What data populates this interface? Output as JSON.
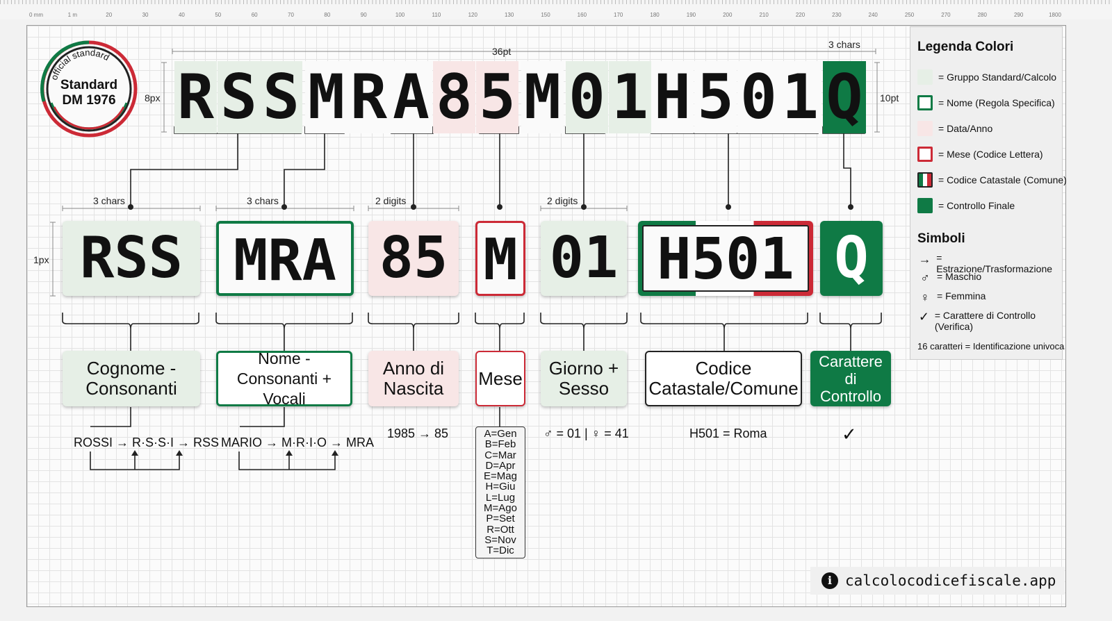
{
  "ruler": {
    "labels": [
      "0 mm",
      "1 m",
      "20",
      "30",
      "40",
      "50",
      "60",
      "70",
      "80",
      "90",
      "100",
      "110",
      "120",
      "130",
      "150",
      "160",
      "170",
      "180",
      "190",
      "200",
      "210",
      "220",
      "230",
      "240",
      "250",
      "270",
      "280",
      "290",
      "1800"
    ]
  },
  "seal": {
    "arc_text": "official standard",
    "line1": "Standard",
    "line2": "DM 1976"
  },
  "code": {
    "characters": [
      "R",
      "S",
      "S",
      "M",
      "R",
      "A",
      "8",
      "5",
      "M",
      "0",
      "1",
      "H",
      "5",
      "0",
      "1",
      "Q"
    ],
    "top_dimension": "36pt",
    "left_dimension": "8px",
    "right_dimension": "10pt",
    "check_dimension": "3 chars"
  },
  "segments": [
    {
      "code": "RSS",
      "count_label": "3 chars",
      "description": "Cognome - Consonanti",
      "example": "ROSSI → R·S·S·I → RSS"
    },
    {
      "code": "MRA",
      "count_label": "3 chars",
      "description": "Nome - Consonanti + Vocali",
      "example": "MARIO → M·R·I·O → MRA"
    },
    {
      "code": "85",
      "count_label": "2 digits",
      "description": "Anno di Nascita",
      "example": "1985 → 85"
    },
    {
      "code": "M",
      "count_label": "",
      "description": "Mese",
      "example": ""
    },
    {
      "code": "01",
      "count_label": "2 digits",
      "description": "Giorno + Sesso",
      "example": "♂ = 01 | ♀ = 41"
    },
    {
      "code": "H501",
      "count_label": "",
      "description": "Codice Catastale/Comune",
      "example": "H501 = Roma"
    },
    {
      "code": "Q",
      "count_label": "",
      "description": "Carattere di Controllo",
      "example": "✓"
    }
  ],
  "row_dimension": "1px",
  "months": [
    "A=Gen",
    "B=Feb",
    "C=Mar",
    "D=Apr",
    "E=Mag",
    "H=Giu",
    "L=Lug",
    "M=Ago",
    "P=Set",
    "R=Ott",
    "S=Nov",
    "T=Dic"
  ],
  "legend": {
    "title": "Legenda Colori",
    "colors": [
      {
        "label": "= Gruppo Standard/Calcolo",
        "style": "light-green"
      },
      {
        "label": "= Nome (Regola Specifica)",
        "style": "green-border"
      },
      {
        "label": "= Data/Anno",
        "style": "light-pink"
      },
      {
        "label": "= Mese (Codice Lettera)",
        "style": "red-border"
      },
      {
        "label": "= Codice Catastale (Comune)",
        "style": "italian-flag"
      },
      {
        "label": "= Controllo Finale",
        "style": "dark-green"
      }
    ],
    "symbols_title": "Simboli",
    "symbols": [
      {
        "icon": "→",
        "label": "= Estrazione/Trasformazione"
      },
      {
        "icon": "♂",
        "label": "= Maschio"
      },
      {
        "icon": "♀",
        "label": "= Femmina"
      },
      {
        "icon": "✓",
        "label": "= Carattere di Controllo (Verifica)"
      }
    ],
    "note": "16 caratteri = Identificazione univoca"
  },
  "footer": {
    "icon": "info-icon",
    "text": "calcolocodicefiscale.app"
  },
  "colors": {
    "green": "#0f7a45",
    "light_green": "#e6efe6",
    "red": "#cc2a36",
    "light_pink": "#f8e6e6",
    "white": "#ffffff"
  }
}
